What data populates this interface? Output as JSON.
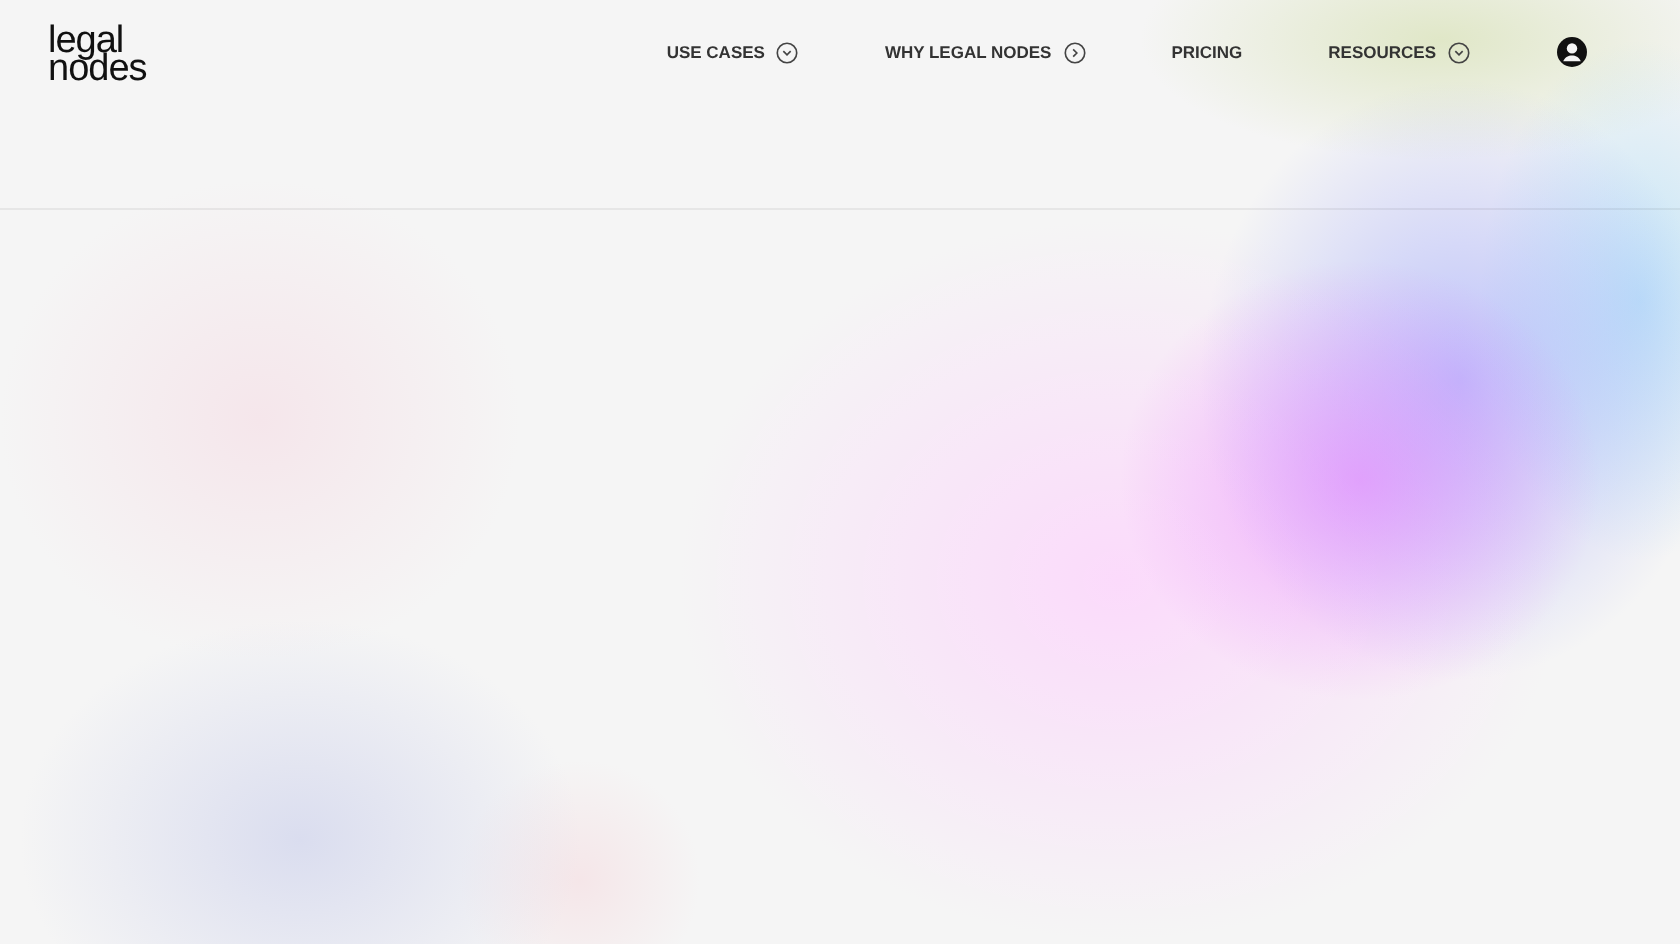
{
  "logo": {
    "lines": [
      "legal",
      "nodes"
    ]
  },
  "nav": [
    {
      "label": "USE CASES",
      "kind": "dropdown"
    },
    {
      "label": "WHY LEGAL NODES",
      "kind": "submenu"
    },
    {
      "label": "PRICING",
      "kind": "link"
    },
    {
      "label": "RESOURCES",
      "kind": "dropdown"
    }
  ]
}
